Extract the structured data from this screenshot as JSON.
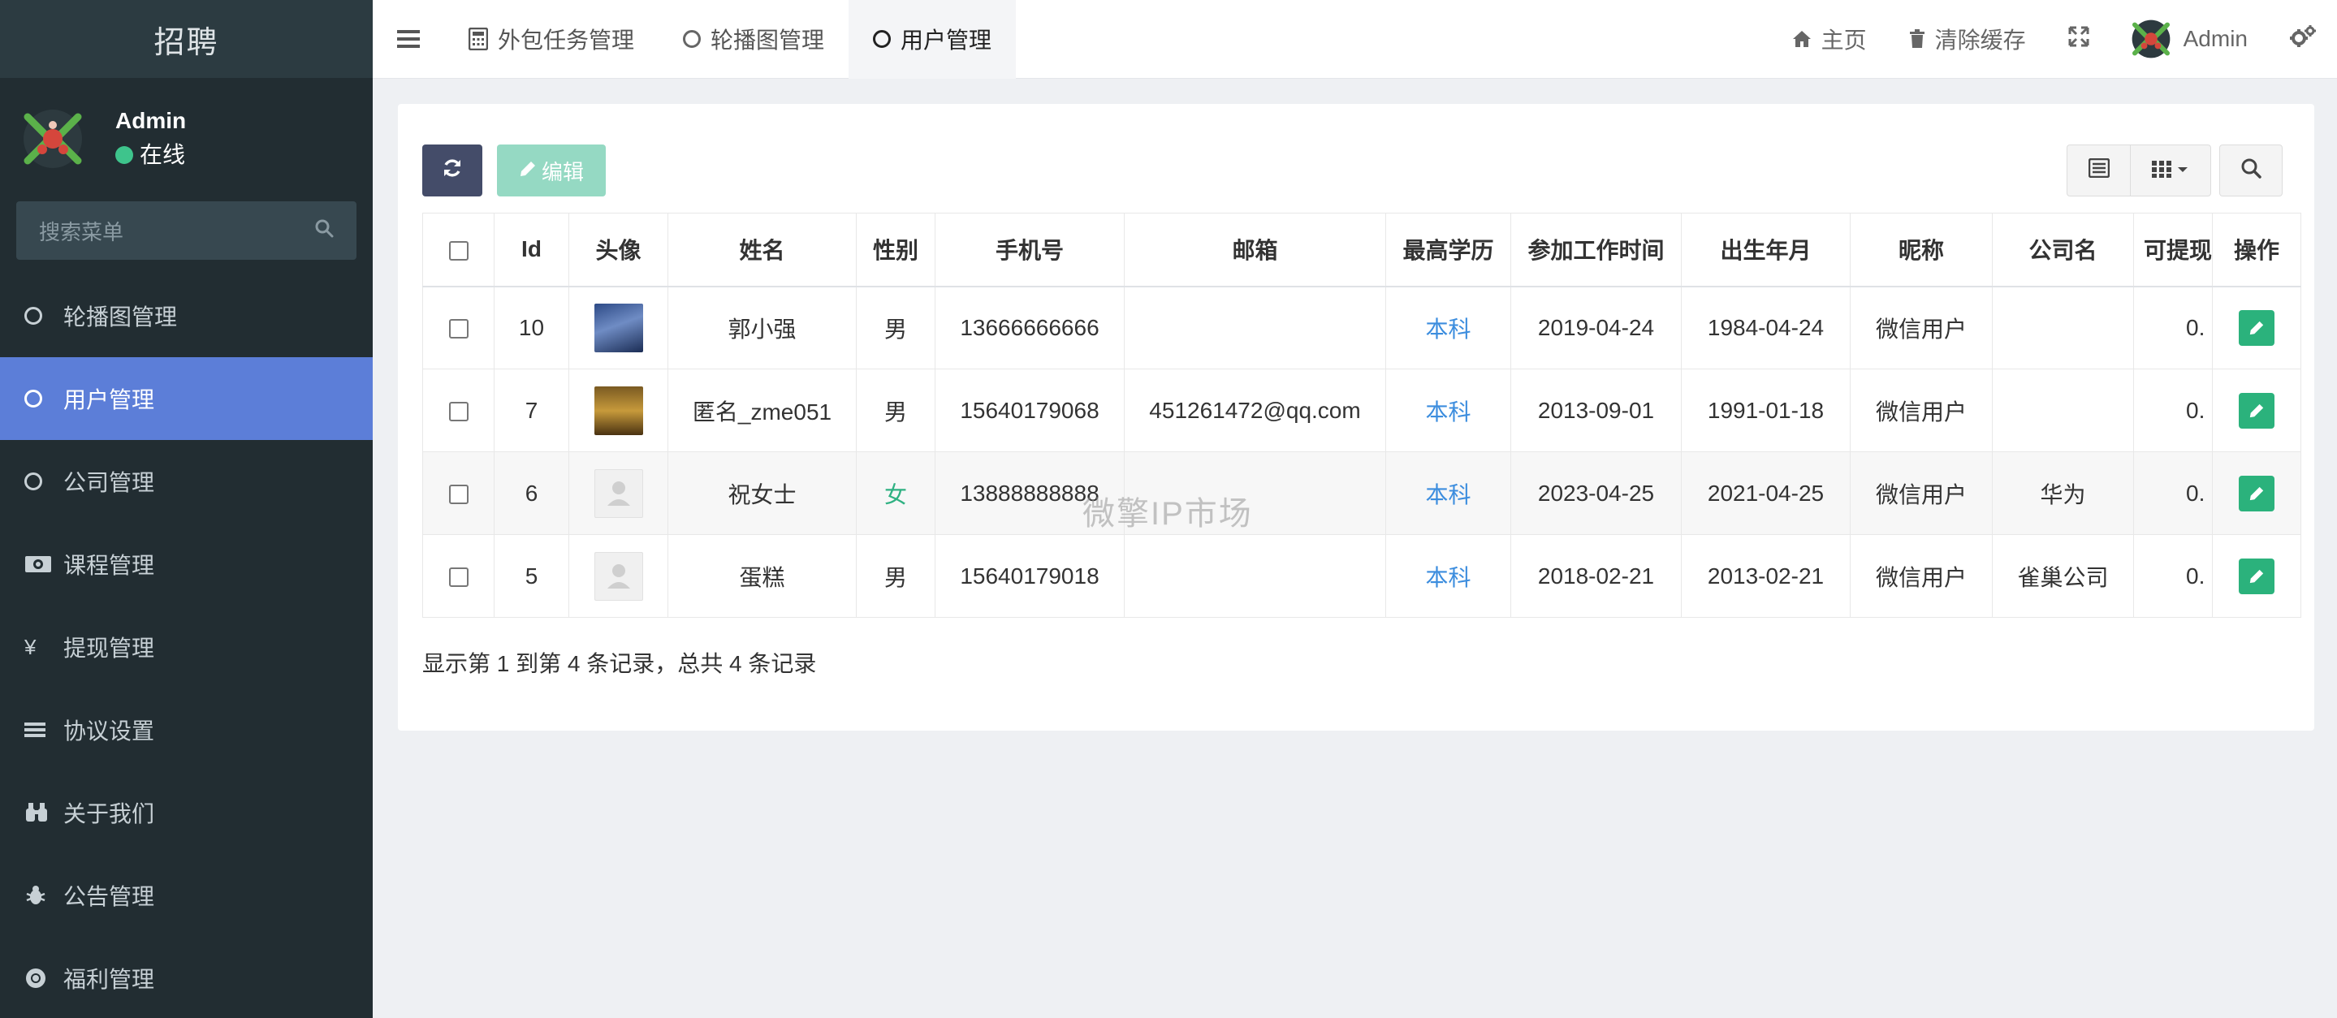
{
  "sidebar": {
    "brand": "招聘",
    "user": {
      "name": "Admin",
      "status": "在线"
    },
    "search_placeholder": "搜索菜单",
    "items": [
      {
        "label": "轮播图管理",
        "icon": "circle-icon",
        "active": false
      },
      {
        "label": "用户管理",
        "icon": "circle-icon",
        "active": true
      },
      {
        "label": "公司管理",
        "icon": "circle-icon",
        "active": false
      },
      {
        "label": "课程管理",
        "icon": "money-icon",
        "active": false
      },
      {
        "label": "提现管理",
        "icon": "yen-icon",
        "active": false
      },
      {
        "label": "协议设置",
        "icon": "list-icon",
        "active": false
      },
      {
        "label": "关于我们",
        "icon": "binoculars-icon",
        "active": false
      },
      {
        "label": "公告管理",
        "icon": "bug-icon",
        "active": false
      },
      {
        "label": "福利管理",
        "icon": "chrome-icon",
        "active": false
      }
    ]
  },
  "topbar": {
    "tabs": [
      {
        "label": "外包任务管理",
        "icon": "calculator-icon"
      },
      {
        "label": "轮播图管理",
        "icon": "circle-icon"
      },
      {
        "label": "用户管理",
        "icon": "circle-icon",
        "active": true
      }
    ],
    "home": "主页",
    "clear_cache": "清除缓存",
    "admin": "Admin"
  },
  "toolbar": {
    "edit_label": "编辑"
  },
  "table": {
    "columns": [
      "Id",
      "头像",
      "姓名",
      "性别",
      "手机号",
      "邮箱",
      "最高学历",
      "参加工作时间",
      "出生年月",
      "昵称",
      "公司名",
      "可提现",
      "操作"
    ],
    "rows": [
      {
        "id": "10",
        "avatar": "car",
        "name": "郭小强",
        "gender": "男",
        "phone": "13666666666",
        "email": "",
        "edu": "本科",
        "work_date": "2019-04-24",
        "birth": "1984-04-24",
        "nickname": "微信用户",
        "company": "",
        "withdraw": "0."
      },
      {
        "id": "7",
        "avatar": "person",
        "name": "匿名_zme051",
        "gender": "男",
        "phone": "15640179068",
        "email": "451261472@qq.com",
        "edu": "本科",
        "work_date": "2013-09-01",
        "birth": "1991-01-18",
        "nickname": "微信用户",
        "company": "",
        "withdraw": "0."
      },
      {
        "id": "6",
        "avatar": "default",
        "name": "祝女士",
        "gender": "女",
        "phone": "13888888888",
        "email": "",
        "edu": "本科",
        "work_date": "2023-04-25",
        "birth": "2021-04-25",
        "nickname": "微信用户",
        "company": "华为",
        "withdraw": "0."
      },
      {
        "id": "5",
        "avatar": "default",
        "name": "蛋糕",
        "gender": "男",
        "phone": "15640179018",
        "email": "",
        "edu": "本科",
        "work_date": "2018-02-21",
        "birth": "2013-02-21",
        "nickname": "微信用户",
        "company": "雀巢公司",
        "withdraw": "0."
      }
    ]
  },
  "pagination_text": "显示第 1 到第 4 条记录，总共 4 条记录",
  "watermark": "微擎IP市场",
  "colors": {
    "sidebar_bg": "#222d32",
    "active_menu": "#5c7ed8",
    "edit_btn": "#2bb27c",
    "link_blue": "#3c8dde"
  }
}
